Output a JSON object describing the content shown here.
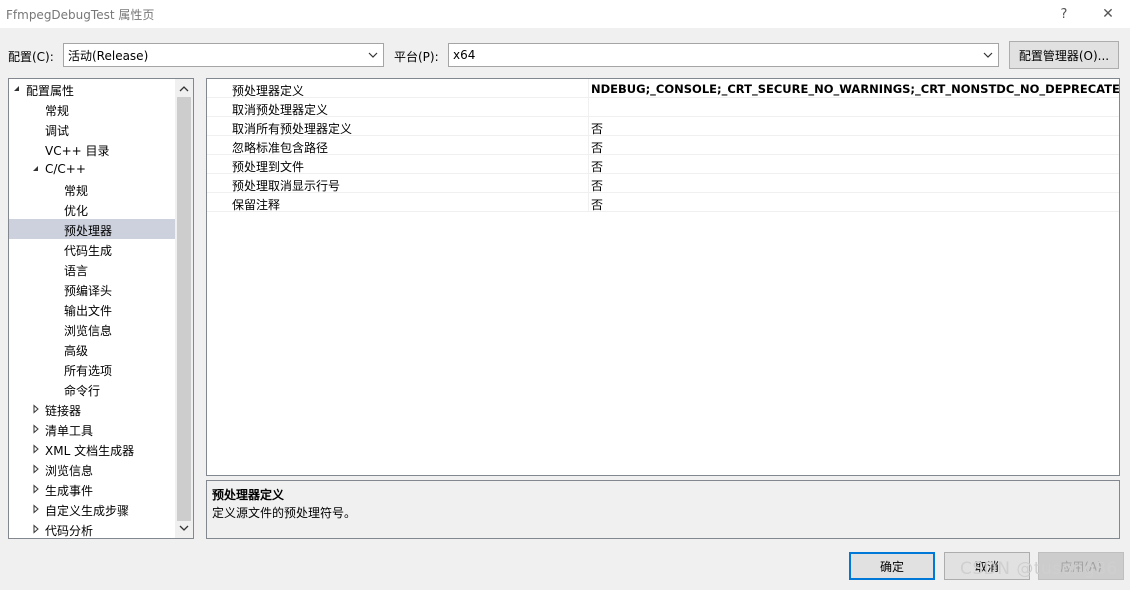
{
  "window": {
    "title": "FfmpegDebugTest 属性页",
    "help_label": "?",
    "close_label": "✕"
  },
  "toolbar": {
    "config_label": "配置(C):",
    "config_value": "活动(Release)",
    "platform_label": "平台(P):",
    "platform_value": "x64",
    "config_manager_label": "配置管理器(O)..."
  },
  "tree": {
    "items": [
      {
        "label": "配置属性",
        "expander": "expanded"
      },
      {
        "label": "常规",
        "expander": "none"
      },
      {
        "label": "调试",
        "expander": "none"
      },
      {
        "label": "VC++ 目录",
        "expander": "none"
      },
      {
        "label": "C/C++",
        "expander": "expanded"
      },
      {
        "label": "常规",
        "expander": "none"
      },
      {
        "label": "优化",
        "expander": "none"
      },
      {
        "label": "预处理器",
        "expander": "none",
        "selected": true
      },
      {
        "label": "代码生成",
        "expander": "none"
      },
      {
        "label": "语言",
        "expander": "none"
      },
      {
        "label": "预编译头",
        "expander": "none"
      },
      {
        "label": "输出文件",
        "expander": "none"
      },
      {
        "label": "浏览信息",
        "expander": "none"
      },
      {
        "label": "高级",
        "expander": "none"
      },
      {
        "label": "所有选项",
        "expander": "none"
      },
      {
        "label": "命令行",
        "expander": "none"
      },
      {
        "label": "链接器",
        "expander": "collapsed"
      },
      {
        "label": "清单工具",
        "expander": "collapsed"
      },
      {
        "label": "XML 文档生成器",
        "expander": "collapsed"
      },
      {
        "label": "浏览信息",
        "expander": "collapsed"
      },
      {
        "label": "生成事件",
        "expander": "collapsed"
      },
      {
        "label": "自定义生成步骤",
        "expander": "collapsed"
      },
      {
        "label": "代码分析",
        "expander": "collapsed"
      }
    ]
  },
  "properties": {
    "rows": [
      {
        "name": "预处理器定义",
        "value": "NDEBUG;_CONSOLE;_CRT_SECURE_NO_WARNINGS;_CRT_NONSTDC_NO_DEPRECATE;%(P",
        "bold": true
      },
      {
        "name": "取消预处理器定义",
        "value": "",
        "bold": false
      },
      {
        "name": "取消所有预处理器定义",
        "value": "否",
        "bold": false
      },
      {
        "name": "忽略标准包含路径",
        "value": "否",
        "bold": false
      },
      {
        "name": "预处理到文件",
        "value": "否",
        "bold": false
      },
      {
        "name": "预处理取消显示行号",
        "value": "否",
        "bold": false
      },
      {
        "name": "保留注释",
        "value": "否",
        "bold": false
      }
    ]
  },
  "description": {
    "title": "预处理器定义",
    "text": "定义源文件的预处理符号。"
  },
  "footer": {
    "ok_label": "确定",
    "cancel_label": "取消",
    "apply_label": "应用(A)"
  },
  "watermark": "CSDN @tusong86",
  "colors": {
    "selection": "#cdd1de",
    "accent": "#0078d7"
  }
}
